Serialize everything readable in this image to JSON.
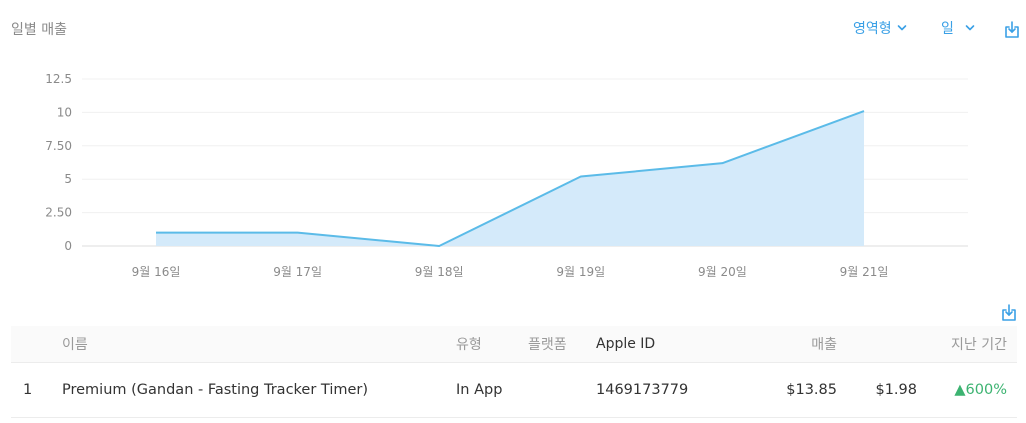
{
  "header": {
    "title": "일별 매출",
    "chart_type_label": "영역형",
    "period_label": "일"
  },
  "icons": {
    "download": "download-icon",
    "chevron": "chevron-down-icon"
  },
  "colors": {
    "accent": "#3aa0e6",
    "area_fill": "#d4eafa",
    "line": "#5bbbe8",
    "positive": "#3cb371"
  },
  "chart_data": {
    "type": "area",
    "x": [
      "9월 16일",
      "9월 17일",
      "9월 18일",
      "9월 19일",
      "9월 20일",
      "9월 21일"
    ],
    "series": [
      {
        "values": [
          1.0,
          1.0,
          0.0,
          5.2,
          6.2,
          10.1
        ]
      }
    ],
    "ylim": [
      0,
      12.5
    ],
    "yticks": [
      "0",
      "2.50",
      "5",
      "7.50",
      "10",
      "12.5"
    ],
    "grid": true
  },
  "table": {
    "headers": {
      "name": "이름",
      "type": "유형",
      "platform": "플랫폼",
      "apple_id": "Apple ID",
      "revenue": "매출",
      "last_period": "지난 기간"
    },
    "rows": [
      {
        "rank": "1",
        "name": "Premium (Gandan - Fasting Tracker Timer)",
        "type": "In App",
        "platform": "",
        "apple_id": "1469173779",
        "revenue": "$13.85",
        "last_period_value": "$1.98",
        "change": "▲600%"
      }
    ]
  }
}
